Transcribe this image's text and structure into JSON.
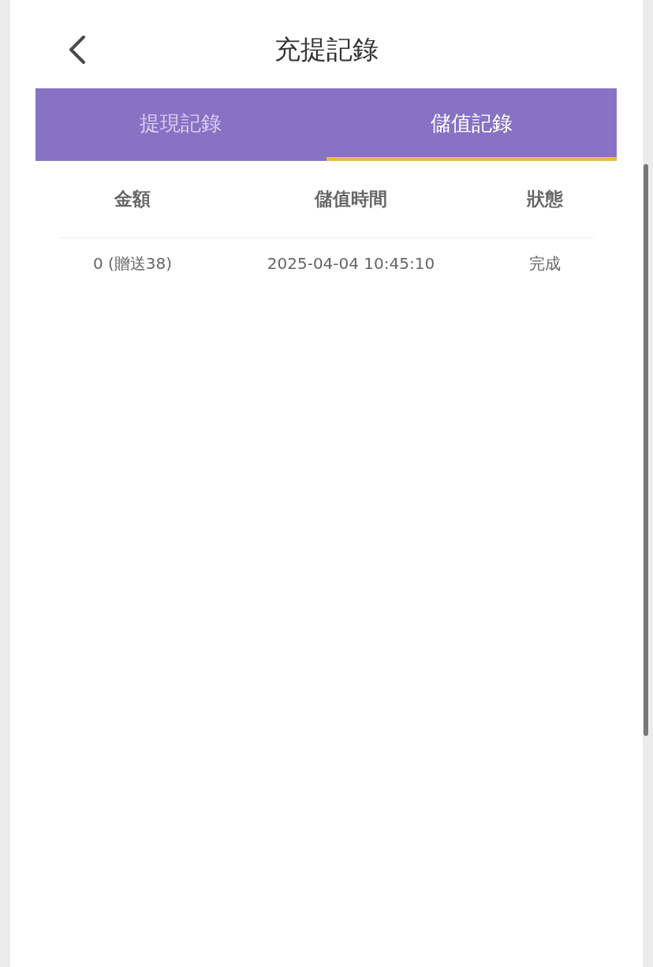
{
  "header": {
    "title": "充提記錄"
  },
  "tabs": [
    {
      "label": "提現記錄",
      "selected": false
    },
    {
      "label": "儲值記錄",
      "selected": true
    }
  ],
  "table": {
    "columns": [
      "金額",
      "儲值時間",
      "狀態"
    ],
    "rows": [
      [
        "0 (贈送38)",
        "2025-04-04 10:45:10",
        "完成"
      ]
    ]
  }
}
